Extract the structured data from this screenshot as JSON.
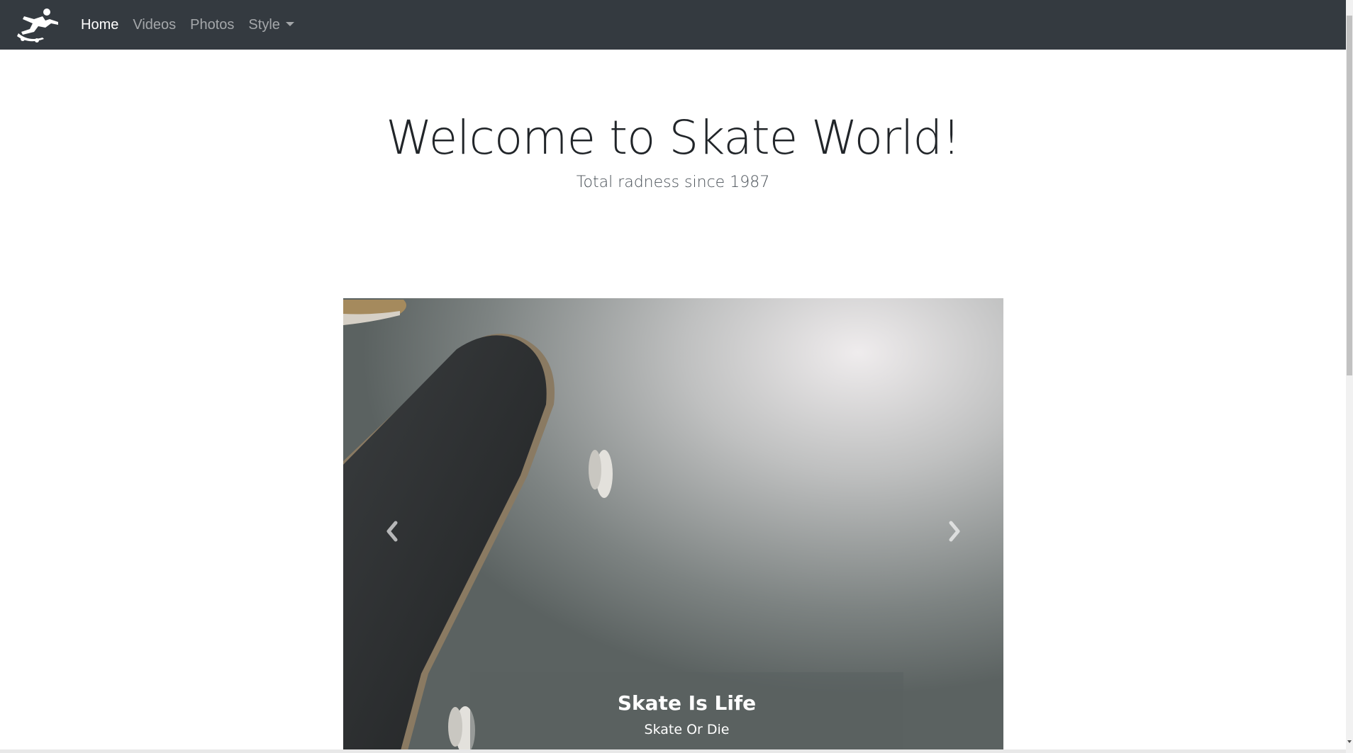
{
  "navbar": {
    "brand_icon": "skateboarder-icon",
    "items": [
      {
        "label": "Home",
        "active": true
      },
      {
        "label": "Videos",
        "active": false
      },
      {
        "label": "Photos",
        "active": false
      },
      {
        "label": "Style",
        "active": false,
        "dropdown": true
      }
    ]
  },
  "hero": {
    "title": "Welcome to Skate World!",
    "subtitle": "Total radness since 1987"
  },
  "carousel": {
    "slide_image": "skateboard-on-concrete",
    "prev_icon": "chevron-left-icon",
    "next_icon": "chevron-right-icon",
    "caption": {
      "title": "Skate Is Life",
      "text": "Skate Or Die"
    }
  },
  "colors": {
    "navbar_bg": "#343a40",
    "nav_active": "#ffffff",
    "nav_inactive": "rgba(255,255,255,0.55)"
  }
}
